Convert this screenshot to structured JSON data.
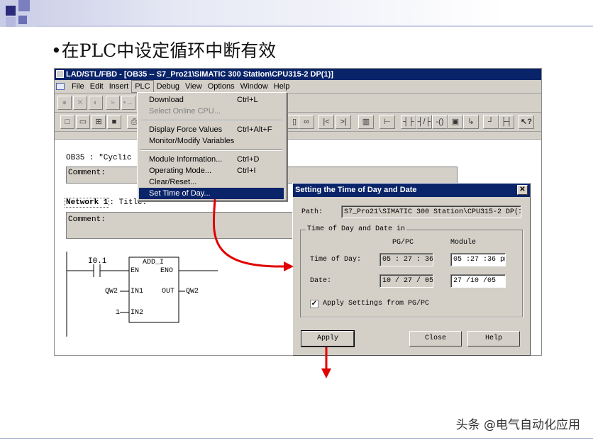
{
  "slide": {
    "title": "•在PLC中设定循环中断有效",
    "watermark": "头条 @电气自动化应用"
  },
  "window": {
    "title": "LAD/STL/FBD  - [OB35 -- S7_Pro21\\SIMATIC 300 Station\\CPU315-2 DP(1)]",
    "menu": [
      "File",
      "Edit",
      "Insert",
      "PLC",
      "Debug",
      "View",
      "Options",
      "Window",
      "Help"
    ],
    "active_menu": "PLC"
  },
  "editor": {
    "block_header": "OB35 :  \"Cyclic",
    "comment_label": "Comment:",
    "network_label": "Network 1",
    "network_title": ": Title:",
    "network_comment_label": "Comment:",
    "contact_label": "I0.1",
    "box_name": "ADD_I",
    "pins": {
      "en": "EN",
      "eno": "ENO",
      "in1": "IN1",
      "in2": "IN2",
      "out": "OUT"
    },
    "in1_operand": "QW2",
    "in2_operand": "1",
    "out_operand": "QW2"
  },
  "plc_menu": {
    "items": [
      {
        "label": "Download",
        "shortcut": "Ctrl+L",
        "disabled": false
      },
      {
        "label": "Select Online CPU...",
        "shortcut": "",
        "disabled": true
      },
      {
        "label": "Display Force Values",
        "shortcut": "Ctrl+Alt+F",
        "disabled": false
      },
      {
        "label": "Monitor/Modify Variables",
        "shortcut": "",
        "disabled": false
      },
      {
        "label": "Module Information...",
        "shortcut": "Ctrl+D",
        "disabled": false
      },
      {
        "label": "Operating Mode...",
        "shortcut": "Ctrl+I",
        "disabled": false
      },
      {
        "label": "Clear/Reset...",
        "shortcut": "",
        "disabled": false
      },
      {
        "label": "Set Time of Day...",
        "shortcut": "",
        "disabled": false,
        "selected": true
      }
    ]
  },
  "dialog": {
    "title": "Setting the Time of Day and Date",
    "path_label": "Path:",
    "path_value": "S7_Pro21\\SIMATIC 300 Station\\CPU315-2 DP(1",
    "group_label": "Time of Day and Date in",
    "col_pgpc": "PG/PC",
    "col_module": "Module",
    "time_label": "Time of Day:",
    "date_label": "Date:",
    "pg_time": "05 : 27 : 36",
    "module_time": "05 :27 :36 pm",
    "pg_date": "10 / 27 / 05",
    "module_date": "27 /10 /05",
    "apply_settings_label": "Apply Settings from PG/PC",
    "apply_settings_checked": true,
    "buttons": {
      "apply": "Apply",
      "close": "Close",
      "help": "Help"
    }
  },
  "colors": {
    "titlebar": "#0a246a",
    "face": "#d4d0c8",
    "arrow": "#e00000"
  }
}
